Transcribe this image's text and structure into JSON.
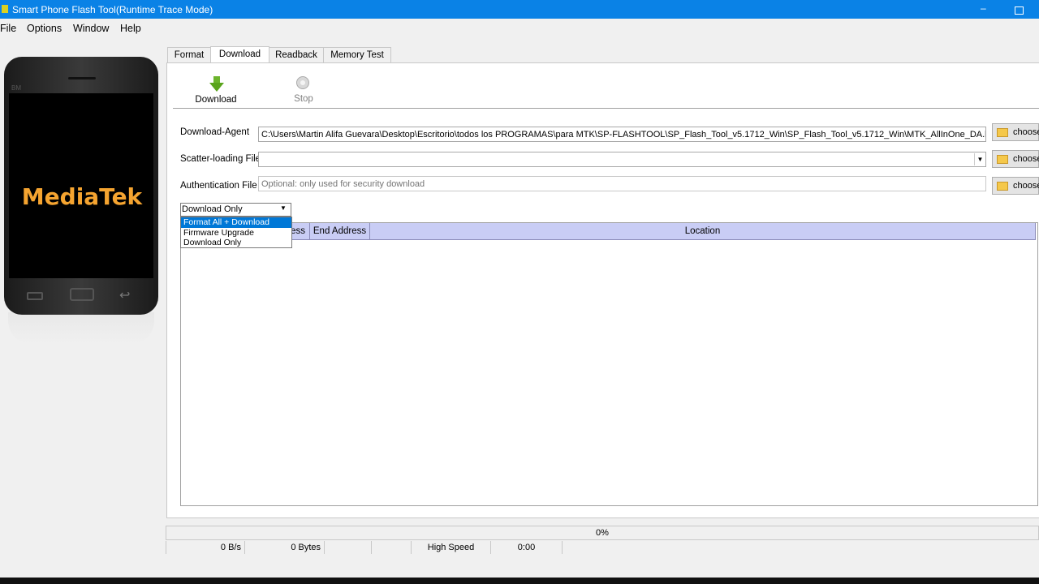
{
  "window": {
    "title": "Smart Phone Flash Tool(Runtime Trace Mode)"
  },
  "menu": [
    "File",
    "Options",
    "Window",
    "Help"
  ],
  "phone": {
    "brand": "MediaTek",
    "model_label": "BM"
  },
  "tabs": [
    "Format",
    "Download",
    "Readback",
    "Memory Test"
  ],
  "active_tab": "Download",
  "toolbar": {
    "download_label": "Download",
    "stop_label": "Stop"
  },
  "form": {
    "download_agent_label": "Download-Agent",
    "download_agent_value": "C:\\Users\\Martin Alifa Guevara\\Desktop\\Escritorio\\todos los PROGRAMAS\\para MTK\\SP-FLASHTOOL\\SP_Flash_Tool_v5.1712_Win\\SP_Flash_Tool_v5.1712_Win\\MTK_AllInOne_DA.bin",
    "scatter_label": "Scatter-loading File",
    "scatter_value": "",
    "auth_label": "Authentication File",
    "auth_placeholder": "Optional: only used for security download",
    "choose_label": "choose"
  },
  "mode_select": {
    "value": "Download Only",
    "options": [
      "Format All + Download",
      "Firmware Upgrade",
      "Download Only"
    ],
    "highlighted": "Format All + Download"
  },
  "table": {
    "columns": [
      "ress",
      "End Address",
      "Location"
    ]
  },
  "status": {
    "progress": "0%",
    "speed": "0 B/s",
    "bytes": "0 Bytes",
    "mode": "High Speed",
    "time": "0:00"
  },
  "colors": {
    "titlebar": "#0a82e6",
    "brand": "#f5a430",
    "table_header": "#c9cdf5",
    "selection": "#0078d7"
  }
}
